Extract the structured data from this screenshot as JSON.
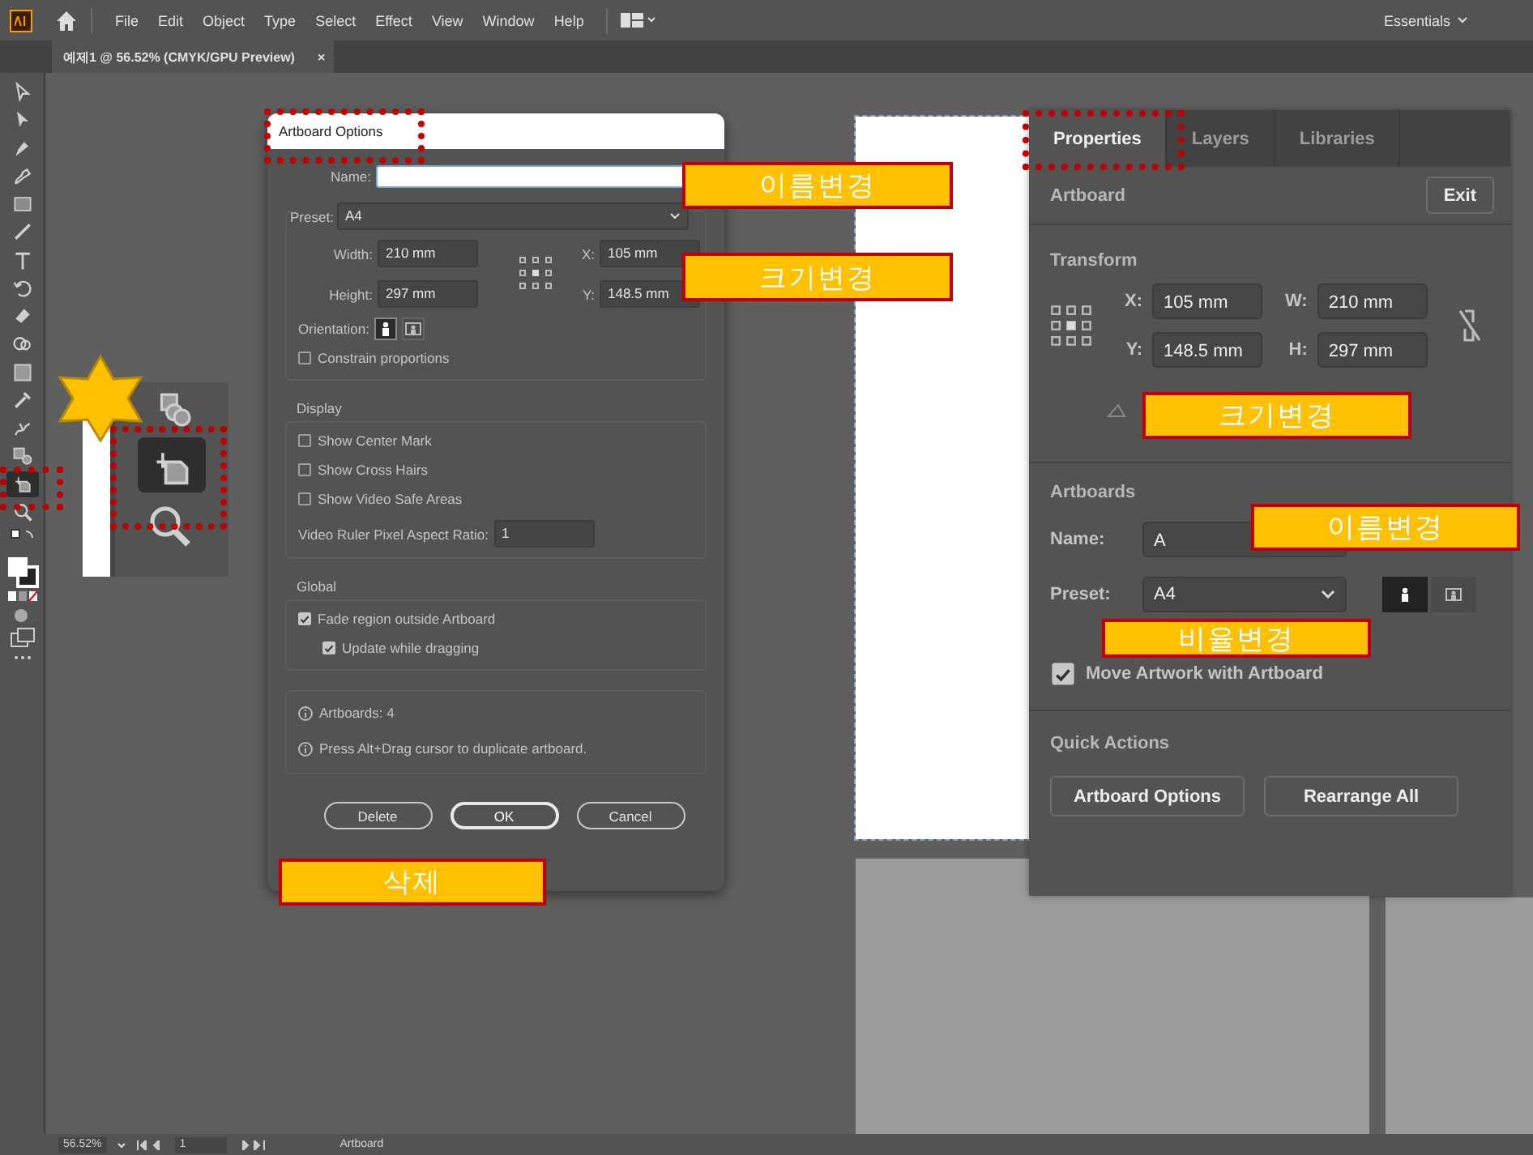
{
  "menu_bar": {
    "items": [
      "File",
      "Edit",
      "Object",
      "Type",
      "Select",
      "Effect",
      "View",
      "Window",
      "Help"
    ],
    "workspace": "Essentials"
  },
  "document_tab": {
    "title": "예제1 @ 56.52% (CMYK/GPU Preview)",
    "close": "×"
  },
  "toolbar": {
    "tools": [
      {
        "kind": "select",
        "selected": false
      },
      {
        "kind": "direct",
        "selected": false
      },
      {
        "kind": "pen",
        "selected": false
      },
      {
        "kind": "curvature",
        "selected": false
      },
      {
        "kind": "rect",
        "selected": false
      },
      {
        "kind": "brush",
        "selected": false
      },
      {
        "kind": "type",
        "selected": false
      },
      {
        "kind": "rotate",
        "selected": false
      },
      {
        "kind": "eraser",
        "selected": false
      },
      {
        "kind": "shapebuilder",
        "selected": false
      },
      {
        "kind": "gradient",
        "selected": false
      },
      {
        "kind": "eyedropper",
        "selected": false
      },
      {
        "kind": "puppet",
        "selected": false
      },
      {
        "kind": "blend",
        "selected": false
      },
      {
        "kind": "artboard",
        "selected": true
      },
      {
        "kind": "zoom",
        "selected": false
      }
    ]
  },
  "dialog": {
    "title": "Artboard Options",
    "name": {
      "label": "Name:"
    },
    "preset": {
      "label": "Preset:",
      "value": "A4"
    },
    "size_fields": [
      {
        "label": "Width:",
        "value": "210 mm"
      },
      {
        "label": "Height:",
        "value": "297 mm"
      }
    ],
    "position_fields": [
      {
        "label": "X:",
        "value": "105 mm"
      },
      {
        "label": "Y:",
        "value": "148.5 mm"
      }
    ],
    "orientation": {
      "label": "Orientation:",
      "options": [
        {
          "kind": "portrait",
          "selected": true
        },
        {
          "kind": "landscape",
          "selected": false
        }
      ]
    },
    "constrain": {
      "label": "Constrain proportions",
      "checked": false
    },
    "display": {
      "title": "Display",
      "options": [
        {
          "label": "Show Center Mark",
          "checked": false
        },
        {
          "label": "Show Cross Hairs",
          "checked": false
        },
        {
          "label": "Show Video Safe Areas",
          "checked": false
        }
      ],
      "ratio": {
        "label": "Video Ruler Pixel Aspect Ratio:",
        "value": "1"
      }
    },
    "global": {
      "title": "Global",
      "options": [
        {
          "label": "Fade region outside Artboard",
          "checked": true,
          "children": [
            {
              "label": "Update while dragging",
              "checked": true
            }
          ]
        }
      ]
    },
    "info": [
      "Artboards: 4",
      "Press Alt+Drag cursor to duplicate artboard."
    ],
    "buttons": [
      {
        "label": "Delete",
        "kind": "normal"
      },
      {
        "label": "OK",
        "kind": "default"
      },
      {
        "label": "Cancel",
        "kind": "normal"
      }
    ]
  },
  "properties_panel": {
    "tabs": [
      {
        "label": "Properties",
        "selected": true
      },
      {
        "label": "Layers",
        "selected": false
      },
      {
        "label": "Libraries",
        "selected": false
      }
    ],
    "artboard": {
      "title": "Artboard",
      "exit": "Exit"
    },
    "transform": {
      "title": "Transform",
      "fields": [
        {
          "label": "X:",
          "value": "105 mm"
        },
        {
          "label": "W:",
          "value": "210 mm"
        },
        {
          "label": "Y:",
          "value": "148.5 mm"
        },
        {
          "label": "H:",
          "value": "297 mm"
        }
      ]
    },
    "artboards": {
      "title": "Artboards",
      "name": {
        "label": "Name:",
        "value": "A"
      },
      "preset": {
        "label": "Preset:",
        "value": "A4"
      },
      "orientation": [
        {
          "kind": "portrait",
          "selected": true
        },
        {
          "kind": "landscape",
          "selected": false
        }
      ],
      "move_artwork": {
        "label": "Move Artwork with Artboard",
        "checked": true
      }
    },
    "quick_actions": {
      "title": "Quick Actions",
      "buttons": [
        "Artboard Options",
        "Rearrange All"
      ]
    }
  },
  "status_bar": {
    "zoom": "56.52%",
    "page": "1",
    "tool": "Artboard"
  },
  "annotations": [
    {
      "text": "이름변경"
    },
    {
      "text": "크기변경"
    },
    {
      "text": "크기변경"
    },
    {
      "text": "이름변경"
    },
    {
      "text": "비율변경"
    },
    {
      "text": "삭제"
    }
  ]
}
